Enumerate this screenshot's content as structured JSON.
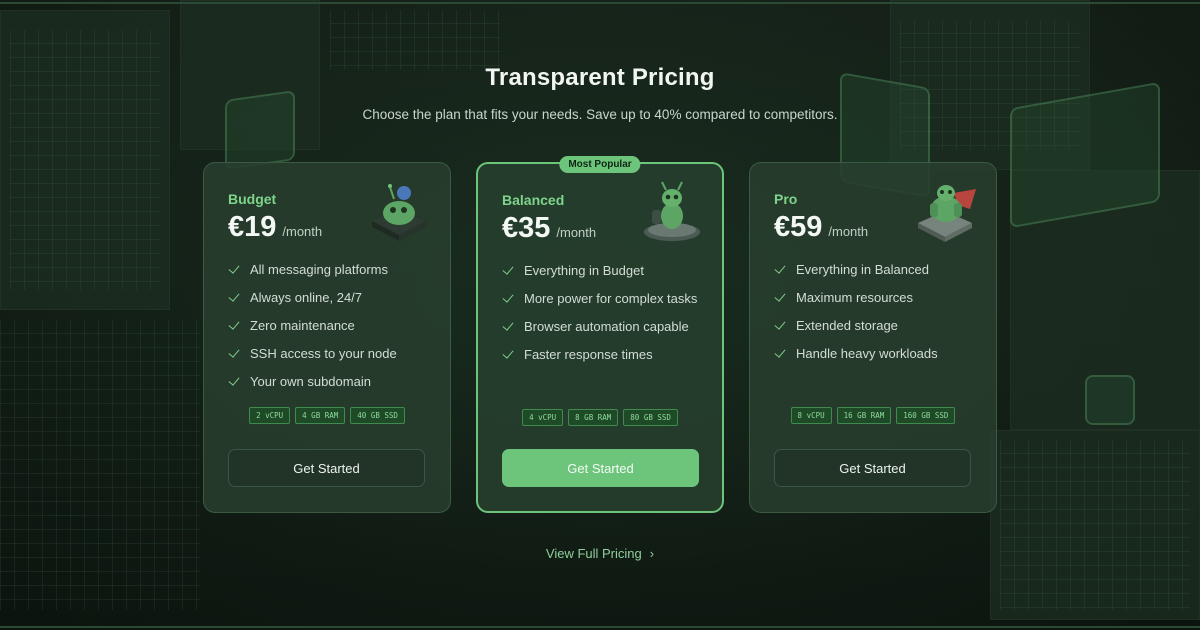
{
  "header": {
    "title": "Transparent Pricing",
    "subtitle": "Choose the plan that fits your needs. Save up to 40% compared to competitors."
  },
  "plans": [
    {
      "name": "Budget",
      "price": "€19",
      "period": "/month",
      "features": [
        "All messaging platforms",
        "Always online, 24/7",
        "Zero maintenance",
        "SSH access to your node",
        "Your own subdomain"
      ],
      "specs": [
        "2 vCPU",
        "4 GB RAM",
        "40 GB SSD"
      ],
      "cta": "Get Started"
    },
    {
      "name": "Balanced",
      "badge": "Most Popular",
      "price": "€35",
      "period": "/month",
      "features": [
        "Everything in Budget",
        "More power for complex tasks",
        "Browser automation capable",
        "Faster response times"
      ],
      "specs": [
        "4 vCPU",
        "8 GB RAM",
        "80 GB SSD"
      ],
      "cta": "Get Started"
    },
    {
      "name": "Pro",
      "price": "€59",
      "period": "/month",
      "features": [
        "Everything in Balanced",
        "Maximum resources",
        "Extended storage",
        "Handle heavy workloads"
      ],
      "specs": [
        "8 vCPU",
        "16 GB RAM",
        "160 GB SSD"
      ],
      "cta": "Get Started"
    }
  ],
  "footer": {
    "view_pricing": "View Full Pricing"
  },
  "colors": {
    "accent": "#6cc57a",
    "background": "#131d16",
    "card": "#283e2e"
  }
}
